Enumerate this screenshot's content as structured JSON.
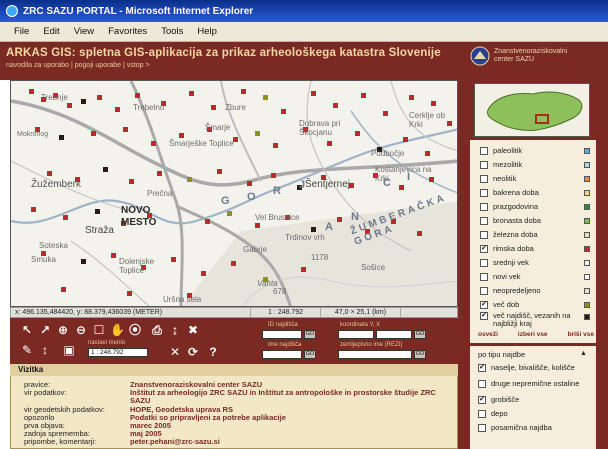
{
  "window": {
    "title": "ZRC SAZU PORTAL - Microsoft Internet Explorer",
    "menu": [
      "File",
      "Edit",
      "View",
      "Favorites",
      "Tools",
      "Help"
    ]
  },
  "header": {
    "title": "ARKAS GIS: spletna GIS-aplikacija za prikaz arheološkega katastra Slovenije",
    "links": "navodila za uporabo | pogoji uporabe | vstop >",
    "institution": "Znanstvenoraziskovalni center SAZU"
  },
  "map": {
    "places": {
      "trebnje": "Trebnje",
      "trebelno": "Trebelno",
      "zbure": "Zbure",
      "smarje": "Šmarje",
      "smarjeske_toplice": "Šmarješke Toplice",
      "dobrava": "Dobrava pri Škocjanu",
      "cerklje": "Cerklje ob Krki",
      "podbocje": "Podbočje",
      "kostanjevica": "Kostanjevica na Krki",
      "zuzemberk": "Žužemberk",
      "novo_mesto_1": "NOVO",
      "novo_mesto_2": "MESTO",
      "straza": "Straža",
      "sentjernej": "Šentjernej",
      "vel_brusnice": "Vel Brusnice",
      "trdinov_vrh": "Trdinov vrh",
      "sotesko": "Soteska",
      "smuka": "Smuka",
      "dolenjske_toplice": "Dolenjske Toplice",
      "gabrje": "Gabrje",
      "vahta": "Vahta",
      "sosice": "Sošice",
      "ursna_sela": "Uršna sela",
      "precna": "Prečna",
      "mokronog": "Mokronog"
    },
    "mountains": "ŽUMBERAČKA GORA",
    "elevation_1": "1178",
    "elevation_2": "678",
    "gorjanci_letters": [
      "G",
      "O",
      "R",
      "J",
      "A",
      "N",
      "C",
      "I"
    ]
  },
  "status": {
    "coordinates": "x: 496.135,484420, y: 88.379,436039 (METER)",
    "scale": "1 : 248.792",
    "extent": "47,0 × 25,1 (km)"
  },
  "tools": {
    "labels": {
      "id_najdisca": "ID najdišča",
      "koordinata": "koordinata Y, X",
      "nastavi_merilo": "nastavi merilo",
      "ime_najdisca": "ime najdišča",
      "zemljepisno_ime": "zemljepisno ime (REZI)"
    },
    "scale_value": "1 : 248.792",
    "go_label": "GO"
  },
  "info": {
    "heading": "Vizitka",
    "rows": [
      {
        "label": "pravice:",
        "value": "Znanstvenoraziskovalni center SAZU"
      },
      {
        "label": "vir podatkov:",
        "value": "Inštitut za arheologijo ZRC SAZU in Inštitut za antropološke in prostorske študije ZRC"
      },
      {
        "label": "",
        "value": "SAZU"
      },
      {
        "label": "vir geodetskih podatkov:",
        "value": "HOPE, Geodetska uprava RS"
      },
      {
        "label": "opozorilo",
        "value": "Podatki so pripravljeni za potrebe aplikacije"
      },
      {
        "label": "prva objava:",
        "value": "marec 2005"
      },
      {
        "label": "zadnja sprememba:",
        "value": "maj 2005"
      },
      {
        "label": "pripombe, komentarji:",
        "value": "peter.pehani@zrc-sazu.si"
      }
    ]
  },
  "layers": {
    "items": [
      {
        "label": "paleolitik",
        "checked": false,
        "color": "#6aa7d6"
      },
      {
        "label": "mezolitik",
        "checked": false,
        "color": "#a9d8e8"
      },
      {
        "label": "neolitik",
        "checked": false,
        "color": "#e58a3a"
      },
      {
        "label": "bakrena doba",
        "checked": false,
        "color": "#f2d77a"
      },
      {
        "label": "prazgodovina",
        "checked": false,
        "color": "#2f8b3b"
      },
      {
        "label": "bronasta doba",
        "checked": false,
        "color": "#7bbf4a"
      },
      {
        "label": "železna doba",
        "checked": false,
        "color": "#d8e6a8"
      },
      {
        "label": "rimska doba",
        "checked": true,
        "color": "#c0262b"
      },
      {
        "label": "srednji vek",
        "checked": false,
        "color": "#f6f6f6"
      },
      {
        "label": "novi vek",
        "checked": false,
        "color": "#ffffff"
      },
      {
        "label": "neopredeljeno",
        "checked": false,
        "color": "#e9dcc2"
      },
      {
        "label": "več dob",
        "checked": true,
        "color": "#8f8f1c"
      },
      {
        "label": "več najdišč, vezanih na najbližji kraj",
        "checked": true,
        "color": "#2a1a10"
      }
    ],
    "links": [
      "osveži",
      "izberi vse",
      "briši vse"
    ]
  },
  "types": {
    "heading": "po tipu najdbe",
    "items": [
      {
        "label": "naselje, bivališče, koliščе",
        "checked": true
      },
      {
        "label": "druge nepremične ostaline",
        "checked": false
      },
      {
        "label": "grobišče",
        "checked": true
      },
      {
        "label": "depo",
        "checked": false
      },
      {
        "label": "posamična najdba",
        "checked": false
      }
    ]
  }
}
